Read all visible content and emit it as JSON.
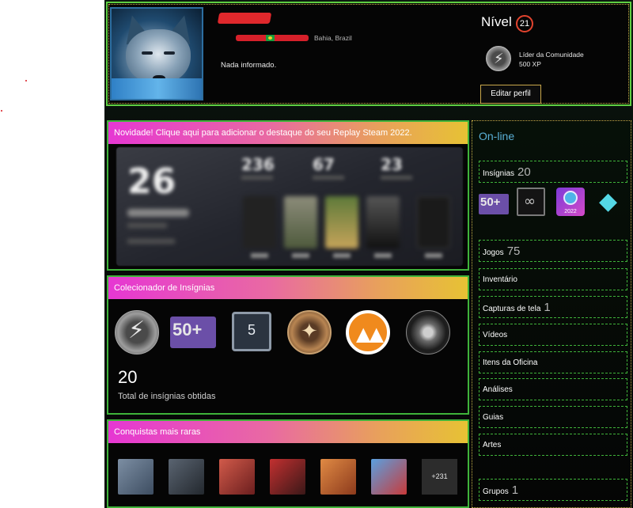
{
  "profile": {
    "location_suffix": "Bahia, Brazil",
    "summary": "Nada informado.",
    "level_label": "Nível",
    "level": "21",
    "xp_badge_name": "Líder da Comunidade",
    "xp_badge_value": "500 XP",
    "edit_button": "Editar perfil"
  },
  "replay": {
    "title": "Novidade! Clique aqui para adicionar o destaque do seu Replay Steam 2022.",
    "big_number": "26",
    "stats": [
      "236",
      "67",
      "23"
    ]
  },
  "badge_collector": {
    "title": "Colecionador de Insígnias",
    "count": "20",
    "total_label": "Total de insígnias obtidas",
    "badge_icons": [
      "lightning-badge-icon",
      "50plus-badge-icon",
      "five-badge-icon",
      "medal-badge-icon",
      "orange-emblem-icon",
      "tire-badge-icon"
    ],
    "badge_50": "50+",
    "badge_5": "5"
  },
  "rare_achievements": {
    "title": "Conquistas mais raras",
    "more": "+231",
    "colors": [
      "#5c6f86",
      "#3f4a57",
      "#b83a3a",
      "#a82b2b",
      "#c8622e",
      "#3b79c4"
    ]
  },
  "sidebar": {
    "status": "On-line",
    "badges_label": "Insígnias",
    "badges_count": "20",
    "games_label": "Jogos",
    "games_count": "75",
    "inventory_label": "Inventário",
    "screenshots_label": "Capturas de tela",
    "screenshots_count": "1",
    "videos_label": "Vídeos",
    "workshop_label": "Itens da Oficina",
    "reviews_label": "Análises",
    "guides_label": "Guias",
    "artwork_label": "Artes",
    "groups_label": "Grupos",
    "groups_count": "1",
    "badge_50": "50+",
    "badge_2022": "2022"
  },
  "colors": {
    "accent_green": "#3fb33a",
    "online_blue": "#5ab0d6",
    "title_gradient_start": "#e637d3",
    "title_gradient_end": "#e7c234"
  }
}
